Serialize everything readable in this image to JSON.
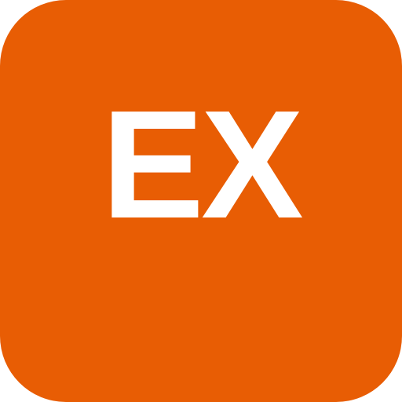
{
  "app_icon": {
    "text": "EX",
    "background_color": "#E85D04",
    "text_color": "#FFFFFF"
  }
}
